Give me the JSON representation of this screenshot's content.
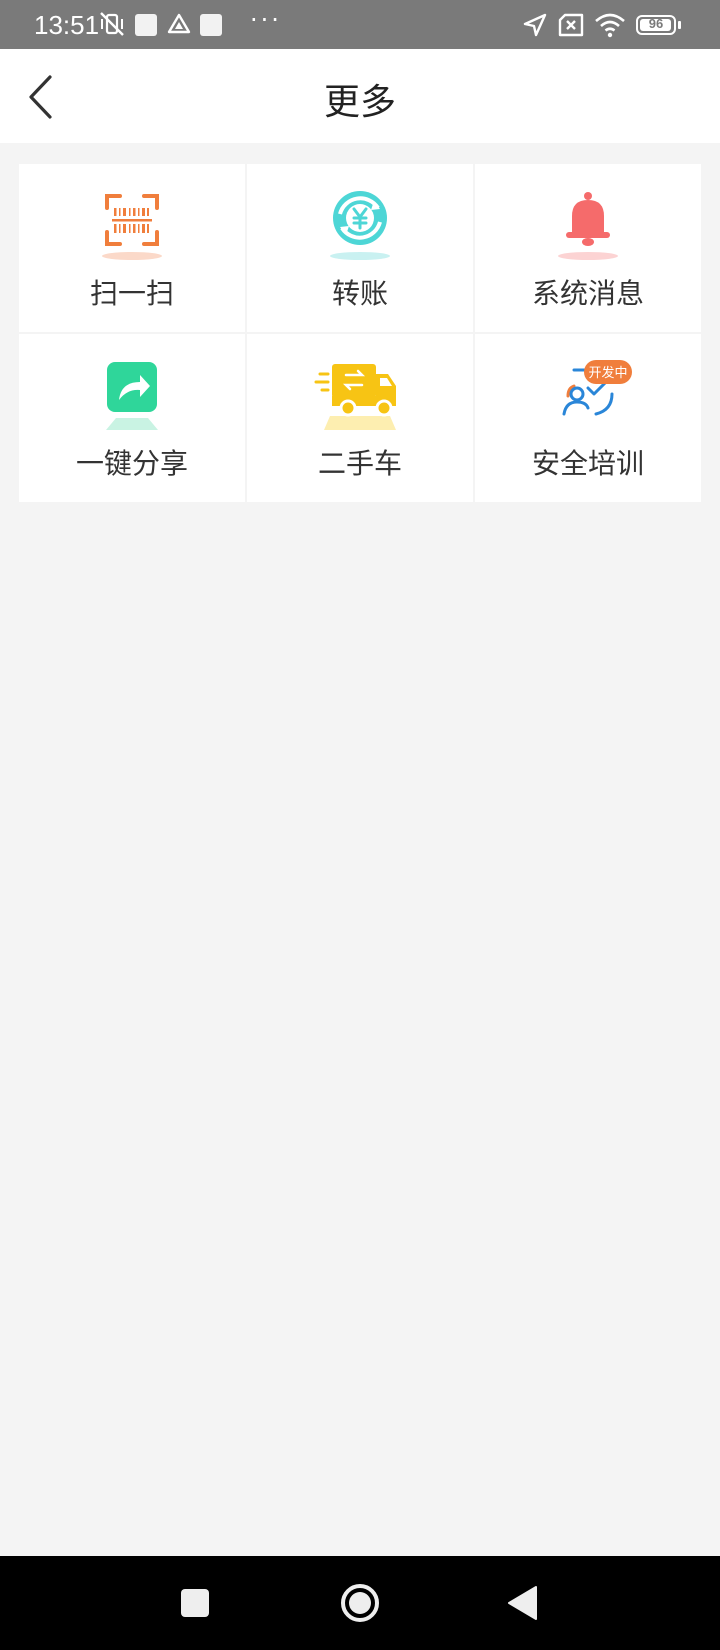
{
  "status_bar": {
    "time": "13:51",
    "battery": "96",
    "battery_level": 0.96,
    "overflow": "···"
  },
  "header": {
    "title": "更多"
  },
  "menu": {
    "items": [
      {
        "label": "扫一扫",
        "icon": "scan-barcode-icon",
        "color": "#f07e3c"
      },
      {
        "label": "转账",
        "icon": "yuan-transfer-icon",
        "color": "#4dd6d6"
      },
      {
        "label": "系统消息",
        "icon": "bell-icon",
        "color": "#f56b6b"
      },
      {
        "label": "一键分享",
        "icon": "share-icon",
        "color": "#2fd69a"
      },
      {
        "label": "二手车",
        "icon": "truck-icon",
        "color": "#f7c414"
      },
      {
        "label": "安全培训",
        "icon": "safety-training-icon",
        "color": "#2a86d8",
        "badge": "开发中",
        "badge_color": "#f07e3c"
      }
    ]
  }
}
